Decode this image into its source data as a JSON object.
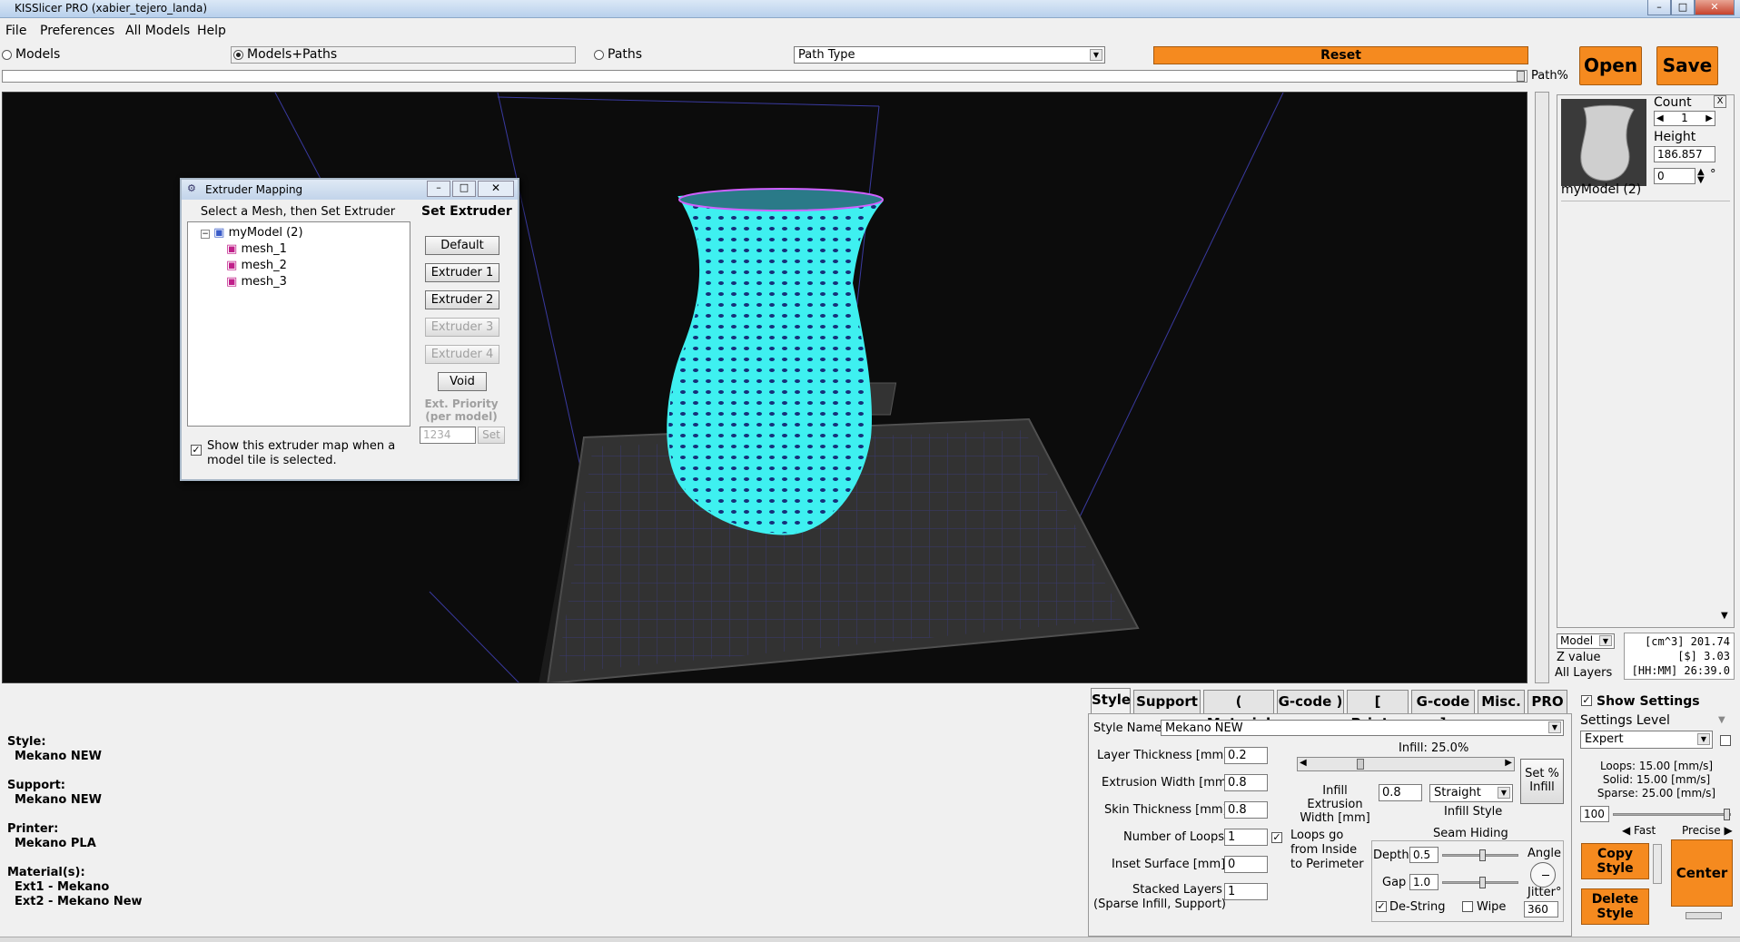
{
  "window": {
    "title": "KISSlicer PRO (xabier_tejero_landa)"
  },
  "menu": [
    "File",
    "Preferences",
    "All Models",
    "Help"
  ],
  "view_modes": {
    "models": "Models",
    "models_paths": "Models+Paths",
    "paths": "Paths",
    "selected": "Models+Paths"
  },
  "path_type": {
    "value": "Path Type"
  },
  "reset_label": "Reset",
  "open_label": "Open",
  "save_label": "Save",
  "path_percent_label": "Path%",
  "extruder_dialog": {
    "title": "Extruder Mapping",
    "instruction": "Select a Mesh, then Set Extruder",
    "set_extruder": "Set Extruder",
    "tree": {
      "root": "myModel (2)",
      "children": [
        "mesh_1",
        "mesh_2",
        "mesh_3"
      ]
    },
    "buttons": [
      "Default",
      "Extruder 1",
      "Extruder 2",
      "Extruder 3",
      "Extruder 4",
      "Void"
    ],
    "priority_label": "Ext. Priority (per model)",
    "priority_value": "1234",
    "set_label": "Set",
    "show_map_label": "Show this extruder map when a model tile is selected."
  },
  "model_panel": {
    "count_label": "Count",
    "count_value": "1",
    "height_label": "Height",
    "height_value": "186.857",
    "rotation_value": "0",
    "degree": "°",
    "model_name": "myModel (2)",
    "close_label": "X",
    "view_select": "Model",
    "z_value": "Z value",
    "all_layers": "All Layers",
    "stats": [
      "[cm^3] 201.74",
      "[$] 3.03",
      "[HH:MM] 26:39.0"
    ]
  },
  "summary": {
    "style_label": "Style:",
    "style_value": "Mekano NEW",
    "support_label": "Support:",
    "support_value": "Mekano NEW",
    "printer_label": "Printer:",
    "printer_value": "Mekano PLA",
    "material_label": "Material(s):",
    "materials": [
      "Ext1 - Mekano",
      "Ext2 - Mekano New"
    ]
  },
  "tabs": [
    "Style",
    "Support",
    "( Material",
    "G-code )",
    "[ Printer",
    "G-code ]",
    "Misc.",
    "PRO"
  ],
  "style_settings": {
    "style_name_label": "Style Name",
    "style_name": "Mekano NEW",
    "layer_thickness_label": "Layer Thickness [mm]",
    "layer_thickness": "0.2",
    "extrusion_width_label": "Extrusion Width [mm]",
    "extrusion_width": "0.8",
    "skin_thickness_label": "Skin Thickness [mm]",
    "skin_thickness": "0.8",
    "loops_label": "Number of Loops",
    "loops": "1",
    "inset_label": "Inset  Surface [mm]",
    "inset": "0",
    "stacked_label": "Stacked Layers",
    "stacked_sub": "(Sparse Infill, Support)",
    "stacked": "1",
    "infill_label": "Infill: 25.0%",
    "infill_fraction": 0.25,
    "set_infill": "Set % Infill",
    "infill_width_label": "Infill Extrusion Width [mm]",
    "infill_width": "0.8",
    "infill_style": "Straight",
    "infill_style_label": "Infill Style",
    "loops_inside_label": "Loops go from Inside to Perimeter",
    "seam_label": "Seam Hiding",
    "depth_label": "Depth",
    "depth": "0.5",
    "gap_label": "Gap",
    "gap": "1.0",
    "angle_label": "Angle",
    "jitter_label": "Jitter°",
    "jitter": "360",
    "destring_label": "De-String",
    "wipe_label": "Wipe"
  },
  "right_settings": {
    "show_settings": "Show Settings",
    "level_label": "Settings Level",
    "level": "Expert",
    "speeds": [
      "Loops:  15.00 [mm/s]",
      "Solid:  15.00 [mm/s]",
      "Sparse: 25.00 [mm/s]"
    ],
    "speed_value": "100",
    "fast": "◀ Fast",
    "precise": "Precise ▶",
    "copy_style": "Copy Style",
    "delete_style": "Delete Style",
    "center": "Center"
  },
  "colors": {
    "orange": "#f58a1f",
    "mesh": "#3ef0f0",
    "viewport": "#0c0c0c"
  }
}
